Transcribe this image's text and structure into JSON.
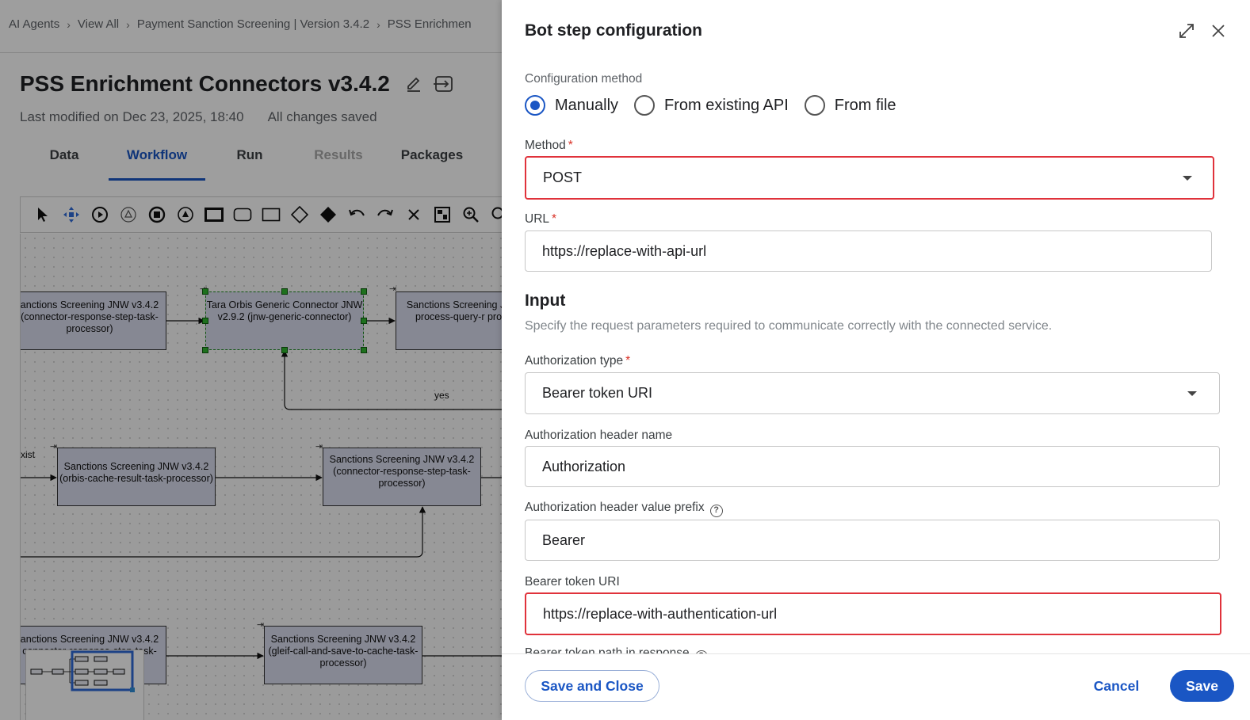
{
  "breadcrumb": [
    "AI Agents",
    "View All",
    "Payment Sanction Screening | Version 3.4.2",
    "PSS Enrichmen"
  ],
  "project": {
    "title": "PSS Enrichment Connectors v3.4.2",
    "last_modified": "Last modified on Dec 23, 2025, 18:40",
    "save_status": "All changes saved"
  },
  "tabs": [
    {
      "label": "Data",
      "state": "normal"
    },
    {
      "label": "Workflow",
      "state": "active"
    },
    {
      "label": "Run",
      "state": "normal"
    },
    {
      "label": "Results",
      "state": "disabled"
    },
    {
      "label": "Packages",
      "state": "normal"
    }
  ],
  "toolbar_icons": [
    "pointer-icon",
    "move-icon",
    "start-event-icon",
    "intermediate-event-icon",
    "end-event-icon",
    "signal-event-icon",
    "task-icon",
    "rounded-task-icon",
    "subprocess-icon",
    "gateway-icon",
    "exclusive-gateway-icon",
    "undo-icon",
    "redo-icon",
    "delete-icon",
    "layout-icon",
    "zoom-in-icon",
    "zoom-out-icon"
  ],
  "workflow": {
    "nodes": [
      {
        "text": "anctions Screening JNW v3.4.2 (connector-response-step-task-processor)"
      },
      {
        "text": "Tara Orbis Generic Connector JNW v2.9.2 (jnw-generic-connector)"
      },
      {
        "text": "Sanctions Screening JN (orbis-process-query-r processor)"
      },
      {
        "text": "Sanctions Screening JNW v3.4.2 (orbis-cache-result-task-processor)"
      },
      {
        "text": "Sanctions Screening JNW v3.4.2 (connector-response-step-task-processor)"
      },
      {
        "text": "anctions Screening JNW v3.4.2 connector-response-step-task-"
      },
      {
        "text": "Sanctions Screening JNW v3.4.2 (gleif-call-and-save-to-cache-task-processor)"
      }
    ],
    "edge_labels": [
      "yes",
      "xist"
    ]
  },
  "drawer": {
    "title": "Bot step configuration",
    "config_method_label": "Configuration method",
    "config_methods": [
      {
        "label": "Manually",
        "selected": true
      },
      {
        "label": "From existing API",
        "selected": false
      },
      {
        "label": "From file",
        "selected": false
      }
    ],
    "method": {
      "label": "Method",
      "value": "POST"
    },
    "url": {
      "label": "URL",
      "value": "https://replace-with-api-url"
    },
    "input": {
      "title": "Input",
      "description": "Specify the request parameters required to communicate correctly with the connected service."
    },
    "auth_type": {
      "label": "Authorization type",
      "value": "Bearer token URI"
    },
    "auth_header_name": {
      "label": "Authorization header name",
      "value": "Authorization"
    },
    "auth_header_prefix": {
      "label": "Authorization header value prefix",
      "value": "Bearer"
    },
    "bearer_token_uri": {
      "label": "Bearer token URI",
      "value": "https://replace-with-authentication-url"
    },
    "bearer_token_path": {
      "label": "Bearer token path in response"
    },
    "buttons": {
      "save_close": "Save and Close",
      "cancel": "Cancel",
      "save": "Save"
    }
  },
  "colors": {
    "accent": "#1a56c4",
    "error": "#e0323b",
    "node_fill": "#d8dbee"
  }
}
